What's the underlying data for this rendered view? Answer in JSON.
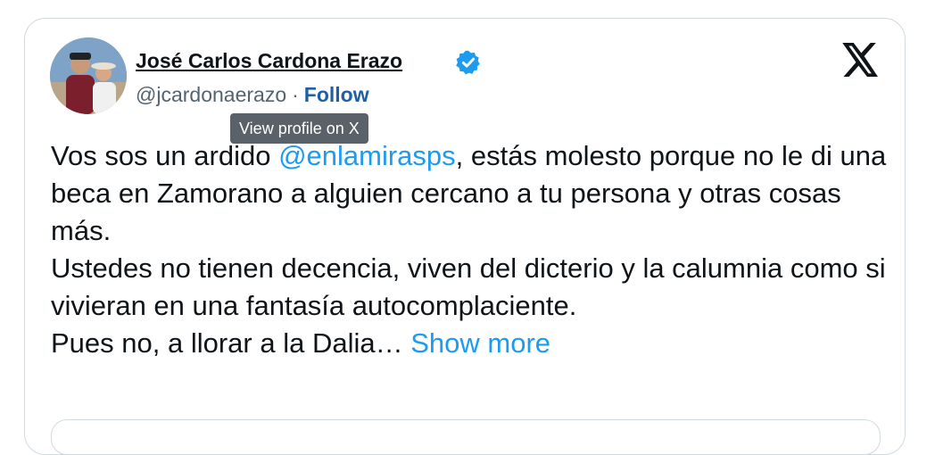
{
  "author": {
    "display_name": "José Carlos Cardona Erazo",
    "handle": "@jcardonaerazo",
    "separator": "·",
    "follow_label": "Follow",
    "avatar_icon": "profile-photo",
    "verified_icon": "verified-badge-icon"
  },
  "tooltip": {
    "text": "View profile on X"
  },
  "brand": {
    "logo_icon": "x-logo-icon"
  },
  "tweet": {
    "line1_before": "Vos sos un ardido ",
    "mention": "@enlamirasps",
    "line1_after": ", estás molesto porque no le di una beca en Zamorano a alguien cercano a tu persona y otras cosas más.",
    "line2": "Ustedes no tienen decencia, viven del dicterio y la calumnia como si vivieran en una fantasía autocomplaciente.",
    "line3": "Pues no, a llorar a la Dalia…",
    "show_more_label": "Show more"
  },
  "colors": {
    "link": "#1d9bf0",
    "follow": "#1d5fa8",
    "text": "#0f1419",
    "muted": "#536471",
    "border": "#cfd9de"
  }
}
